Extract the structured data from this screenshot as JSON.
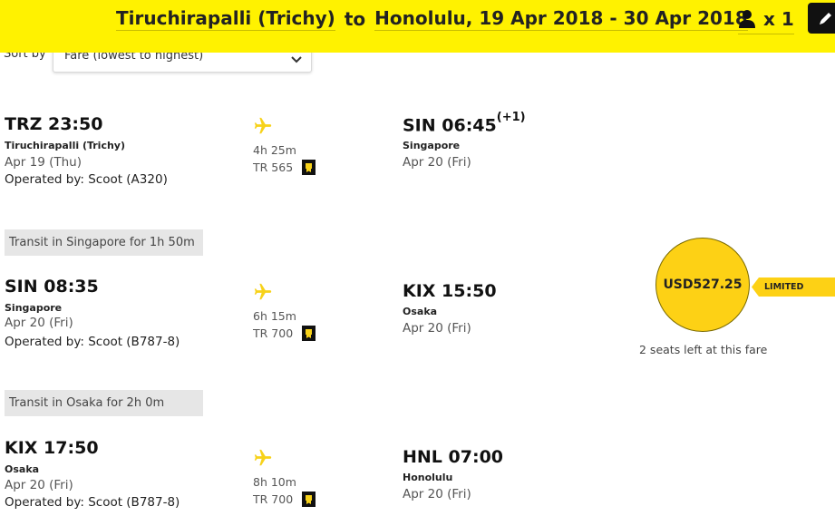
{
  "header": {
    "origin": "Tiruchirapalli (Trichy)",
    "connector": "to",
    "destination_dates": "Honolulu, 19 Apr 2018 - 30 Apr 2018",
    "passengers": "x 1"
  },
  "sort": {
    "label": "Sort by",
    "selected": "Fare (lowest to highest)"
  },
  "segments": [
    {
      "dep_code_time": "TRZ 23:50",
      "dep_city": "Tiruchirapalli (Trichy)",
      "dep_date": "Apr 19 (Thu)",
      "operated": "Operated by: Scoot  (A320)",
      "duration": "4h 25m",
      "flight_no": "TR 565",
      "arr_code_time": "SIN 06:45",
      "arr_day_offset": "(+1)",
      "arr_city": "Singapore",
      "arr_date": "Apr 20 (Fri)"
    },
    {
      "dep_code_time": "SIN 08:35",
      "dep_city": "Singapore",
      "dep_date": "Apr 20 (Fri)",
      "operated": "Operated by: Scoot  (B787-8)",
      "duration": "6h 15m",
      "flight_no": "TR 700",
      "arr_code_time": "KIX 15:50",
      "arr_day_offset": "",
      "arr_city": "Osaka",
      "arr_date": "Apr 20 (Fri)"
    },
    {
      "dep_code_time": "KIX 17:50",
      "dep_city": "Osaka",
      "dep_date": "Apr 20 (Fri)",
      "operated": "Operated by: Scoot  (B787-8)",
      "duration": "8h 10m",
      "flight_no": "TR 700",
      "arr_code_time": "HNL 07:00",
      "arr_day_offset": "",
      "arr_city": "Honolulu",
      "arr_date": "Apr 20 (Fri)"
    }
  ],
  "transits": [
    "Transit in Singapore for 1h 50m",
    "Transit in Osaka for 2h 0m"
  ],
  "fare": {
    "price": "USD527.25",
    "badge": "LIMITED SEATS",
    "seats_left": "2 seats left at this fare"
  },
  "colors": {
    "brand_yellow": "#fff200",
    "price_yellow": "#fdd115",
    "plane_yellow": "#f7d21a"
  },
  "icons": {
    "passenger": "person-icon",
    "edit": "pencil-icon",
    "plane": "plane-icon",
    "meal": "meal-badge-icon",
    "dropdown": "chevron-down-icon"
  }
}
